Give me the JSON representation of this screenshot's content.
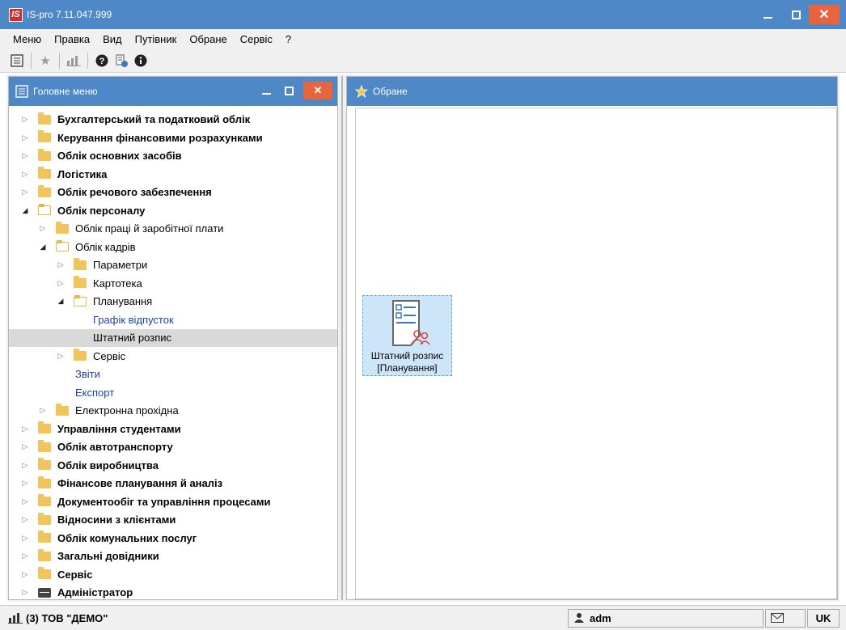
{
  "window": {
    "title": "IS-pro 7.11.047.999",
    "logo": "IS"
  },
  "menubar": {
    "items": [
      "Меню",
      "Правка",
      "Вид",
      "Путівник",
      "Обране",
      "Сервіс",
      "?"
    ]
  },
  "toolbar": {
    "icons": [
      "menu-tree-icon",
      "star-icon",
      "chart-icon",
      "help-icon",
      "context-help-icon",
      "info-icon"
    ]
  },
  "left_panel": {
    "title": "Головне меню",
    "tree": [
      {
        "label": "Бухгалтерський та податковий облік",
        "level": 0,
        "state": "closed",
        "bold": true,
        "icon": "folder"
      },
      {
        "label": "Керування фінансовими розрахунками",
        "level": 0,
        "state": "closed",
        "bold": true,
        "icon": "folder"
      },
      {
        "label": "Облік основних засобів",
        "level": 0,
        "state": "closed",
        "bold": true,
        "icon": "folder"
      },
      {
        "label": "Логістика",
        "level": 0,
        "state": "closed",
        "bold": true,
        "icon": "folder"
      },
      {
        "label": "Облік речового забезпечення",
        "level": 0,
        "state": "closed",
        "bold": true,
        "icon": "folder"
      },
      {
        "label": "Облік персоналу",
        "level": 0,
        "state": "open",
        "bold": true,
        "icon": "folder"
      },
      {
        "label": "Облік праці й заробітної плати",
        "level": 1,
        "state": "closed",
        "bold": false,
        "icon": "folder"
      },
      {
        "label": "Облік кадрів",
        "level": 1,
        "state": "open",
        "bold": false,
        "icon": "folder"
      },
      {
        "label": "Параметри",
        "level": 2,
        "state": "closed",
        "bold": false,
        "icon": "folder"
      },
      {
        "label": "Картотека",
        "level": 2,
        "state": "closed",
        "bold": false,
        "icon": "folder"
      },
      {
        "label": "Планування",
        "level": 2,
        "state": "open",
        "bold": false,
        "icon": "folder"
      },
      {
        "label": "Графік відпусток",
        "level": 3,
        "state": "leaf",
        "bold": false,
        "icon": "none",
        "link": true
      },
      {
        "label": "Штатний розпис",
        "level": 3,
        "state": "leaf",
        "bold": false,
        "icon": "none",
        "selected": true
      },
      {
        "label": "Сервіс",
        "level": 2,
        "state": "closed",
        "bold": false,
        "icon": "folder"
      },
      {
        "label": "Звіти",
        "level": 2,
        "state": "leaf",
        "bold": false,
        "icon": "none",
        "link": true
      },
      {
        "label": "Експорт",
        "level": 2,
        "state": "leaf",
        "bold": false,
        "icon": "none",
        "link": true
      },
      {
        "label": "Електронна прохідна",
        "level": 1,
        "state": "closed",
        "bold": false,
        "icon": "folder"
      },
      {
        "label": "Управління студентами",
        "level": 0,
        "state": "closed",
        "bold": true,
        "icon": "folder"
      },
      {
        "label": "Облік автотранспорту",
        "level": 0,
        "state": "closed",
        "bold": true,
        "icon": "folder"
      },
      {
        "label": "Облік виробництва",
        "level": 0,
        "state": "closed",
        "bold": true,
        "icon": "folder"
      },
      {
        "label": "Фінансове планування й аналіз",
        "level": 0,
        "state": "closed",
        "bold": true,
        "icon": "folder"
      },
      {
        "label": "Документообіг та управління процесами",
        "level": 0,
        "state": "closed",
        "bold": true,
        "icon": "folder"
      },
      {
        "label": "Відносини з клієнтами",
        "level": 0,
        "state": "closed",
        "bold": true,
        "icon": "folder"
      },
      {
        "label": "Облік комунальних послуг",
        "level": 0,
        "state": "closed",
        "bold": true,
        "icon": "folder"
      },
      {
        "label": "Загальні довідники",
        "level": 0,
        "state": "closed",
        "bold": true,
        "icon": "folder"
      },
      {
        "label": "Сервіс",
        "level": 0,
        "state": "closed",
        "bold": true,
        "icon": "folder"
      },
      {
        "label": "Адміністратор",
        "level": 0,
        "state": "closed",
        "bold": true,
        "icon": "admin"
      }
    ]
  },
  "right_panel": {
    "title": "Обране",
    "tile": {
      "line1": "Штатний розпис",
      "line2": "[Планування]"
    }
  },
  "statusbar": {
    "company": "(3) ТОВ \"ДЕМО\"",
    "user": "adm",
    "lang": "UK"
  },
  "colors": {
    "titlebar": "#4e88c6",
    "close": "#e8643c",
    "folder": "#f2c55c",
    "link": "#1e3fa8",
    "tile_bg": "#cde5f8"
  }
}
